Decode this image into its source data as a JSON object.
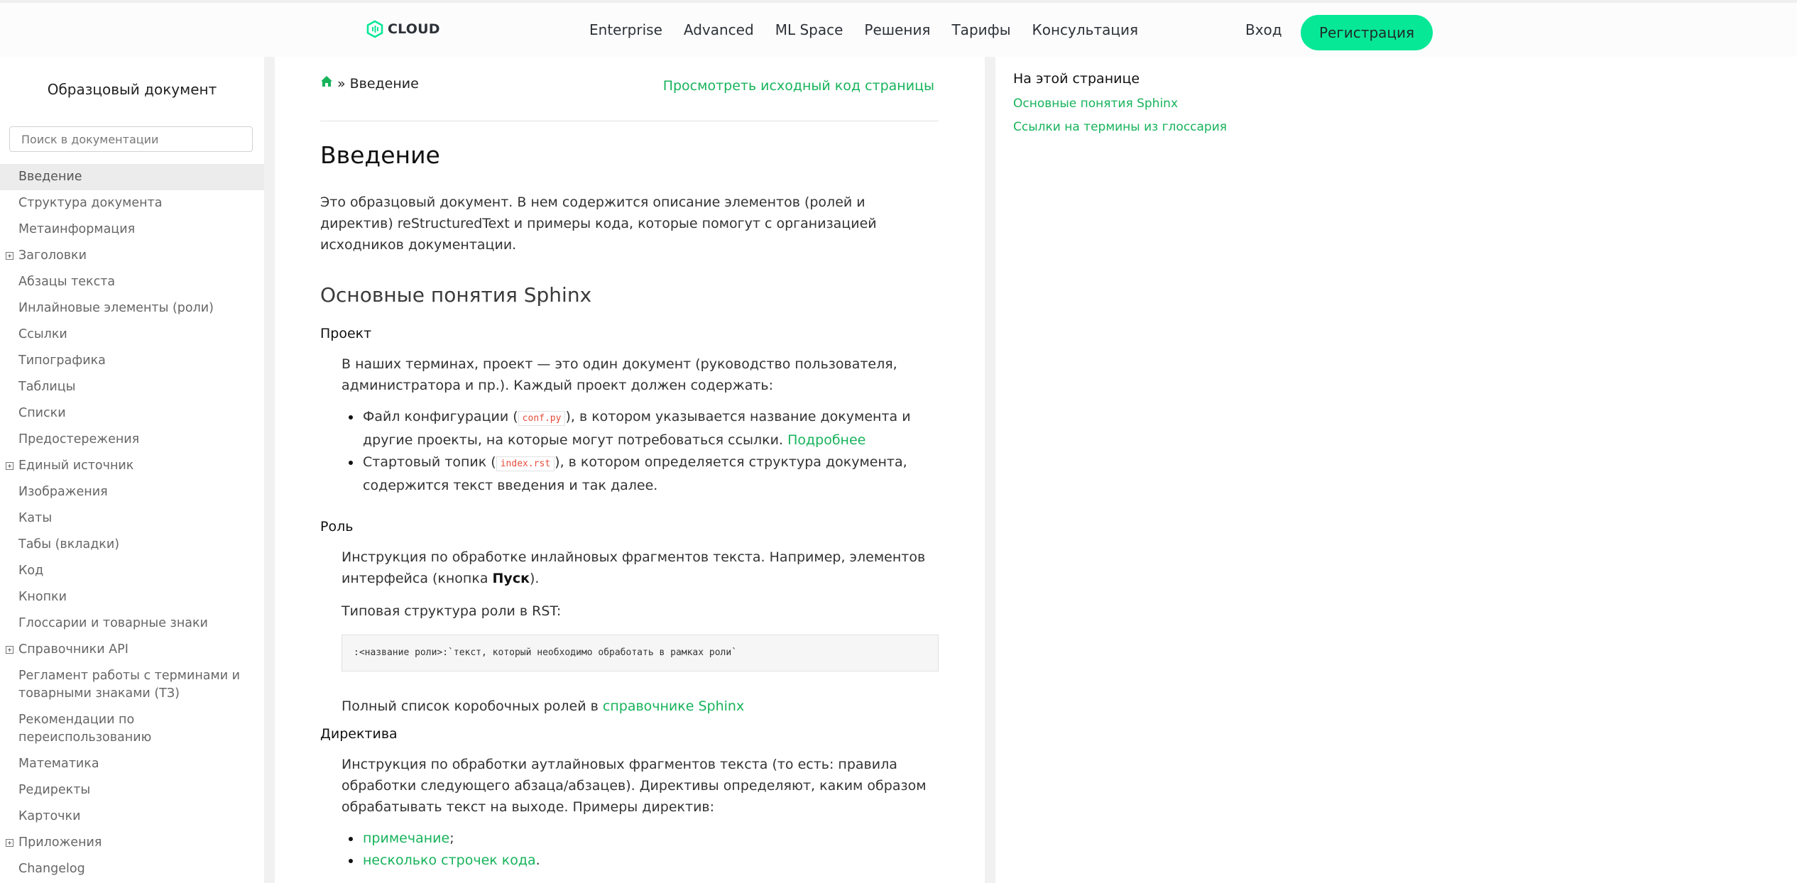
{
  "header": {
    "logo_text": "CLOUD",
    "nav": [
      "Enterprise",
      "Advanced",
      "ML Space",
      "Решения",
      "Тарифы",
      "Консультация"
    ],
    "login_label": "Вход",
    "register_label": "Регистрация",
    "accent_color": "#07e897"
  },
  "sidebar": {
    "title": "Образцовый документ",
    "search_placeholder": "Поиск в документации",
    "items": [
      {
        "label": "Введение",
        "active": true,
        "expandable": false
      },
      {
        "label": "Структура документа",
        "active": false,
        "expandable": false
      },
      {
        "label": "Метаинформация",
        "active": false,
        "expandable": false
      },
      {
        "label": "Заголовки",
        "active": false,
        "expandable": true
      },
      {
        "label": "Абзацы текста",
        "active": false,
        "expandable": false
      },
      {
        "label": "Инлайновые элементы (роли)",
        "active": false,
        "expandable": false
      },
      {
        "label": "Ссылки",
        "active": false,
        "expandable": false
      },
      {
        "label": "Типографика",
        "active": false,
        "expandable": false
      },
      {
        "label": "Таблицы",
        "active": false,
        "expandable": false
      },
      {
        "label": "Списки",
        "active": false,
        "expandable": false
      },
      {
        "label": "Предостережения",
        "active": false,
        "expandable": false
      },
      {
        "label": "Единый источник",
        "active": false,
        "expandable": true
      },
      {
        "label": "Изображения",
        "active": false,
        "expandable": false
      },
      {
        "label": "Каты",
        "active": false,
        "expandable": false
      },
      {
        "label": "Табы (вкладки)",
        "active": false,
        "expandable": false
      },
      {
        "label": "Код",
        "active": false,
        "expandable": false
      },
      {
        "label": "Кнопки",
        "active": false,
        "expandable": false
      },
      {
        "label": "Глоссарии и товарные знаки",
        "active": false,
        "expandable": false
      },
      {
        "label": "Справочники API",
        "active": false,
        "expandable": true
      },
      {
        "label": "Регламент работы с терминами и товарными знаками (ТЗ)",
        "active": false,
        "expandable": false
      },
      {
        "label": "Рекомендации по переиспользованию",
        "active": false,
        "expandable": false
      },
      {
        "label": "Математика",
        "active": false,
        "expandable": false
      },
      {
        "label": "Редиректы",
        "active": false,
        "expandable": false
      },
      {
        "label": "Карточки",
        "active": false,
        "expandable": false
      },
      {
        "label": "Приложения",
        "active": false,
        "expandable": true
      },
      {
        "label": "Changelog",
        "active": false,
        "expandable": false
      }
    ]
  },
  "breadcrumb": {
    "separator": "»",
    "current": "Введение"
  },
  "source_link": "Просмотреть исходный код страницы",
  "content": {
    "title": "Введение",
    "intro": "Это образцовый документ. В нем содержится описание элементов (ролей и директив) reStructuredText и примеры кода, которые помогут с организацией исходников документации.",
    "section_title": "Основные понятия Sphinx",
    "project": {
      "term": "Проект",
      "text": "В наших терминах, проект — это один документ (руководство пользователя, администратора и пр.). Каждый проект должен содержать:",
      "item1_before": "Файл конфигурации (",
      "item1_code": "conf.py",
      "item1_after": "), в котором указывается название документа и другие проекты, на которые могут потребоваться ссылки.",
      "item1_link": "Подробнее",
      "item2_before": "Стартовый топик (",
      "item2_code": "index.rst",
      "item2_after": "), в котором определяется структура документа, содержится текст введения и так далее."
    },
    "role": {
      "term": "Роль",
      "text_before": "Инструкция по обработке инлайновых фрагментов текста. Например, элементов интерфейса (кнопка",
      "text_bold": "Пуск",
      "text_after": ").",
      "structure_label": "Типовая структура роли в RST:",
      "code": ":<название роли>:`текст, который необходимо обработать в рамках роли`",
      "full_list_before": "Полный список коробочных ролей в",
      "full_list_link": "справочнике Sphinx"
    },
    "directive": {
      "term": "Директива",
      "text": "Инструкция по обработки аутлайновых фрагментов текста (то есть: правила обработки следующего абзаца/абзацев). Директивы определяют, каким образом обрабатывать текст на выходе. Примеры директив:",
      "examples": [
        {
          "link": "примечание",
          "suffix": ";"
        },
        {
          "link": "несколько строчек кода",
          "suffix": "."
        }
      ]
    }
  },
  "page_toc": {
    "title": "На этой странице",
    "links": [
      "Основные понятия Sphinx",
      "Ссылки на термины из глоссария"
    ]
  },
  "colors": {
    "link": "#17b35b",
    "inline_code": "#e74c3c"
  }
}
